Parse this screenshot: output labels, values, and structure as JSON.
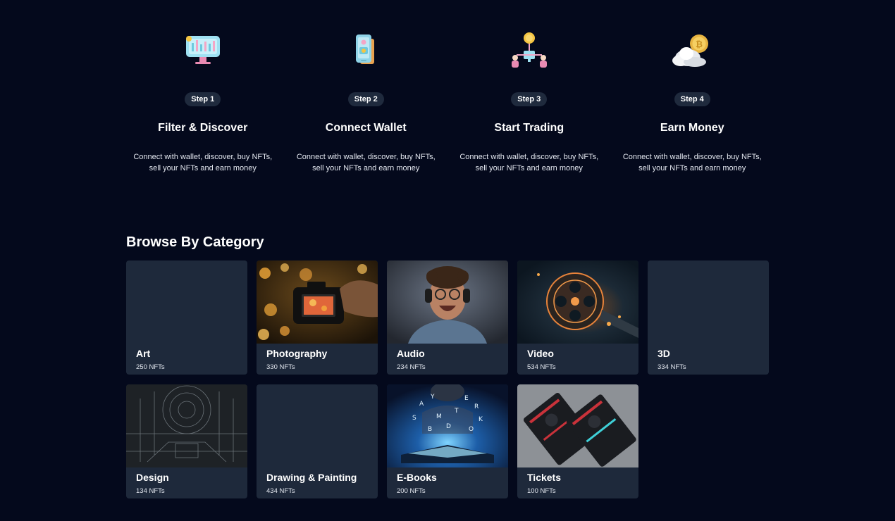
{
  "steps": [
    {
      "pill": "Step 1",
      "title": "Filter & Discover",
      "desc": "Connect with wallet, discover, buy NFTs, sell your NFTs and earn money",
      "icon": "monitor-chart-icon"
    },
    {
      "pill": "Step 2",
      "title": "Connect Wallet",
      "desc": "Connect with wallet, discover, buy NFTs, sell your NFTs and earn money",
      "icon": "phone-wallet-icon"
    },
    {
      "pill": "Step 3",
      "title": "Start Trading",
      "desc": "Connect with wallet, discover, buy NFTs, sell your NFTs and earn money",
      "icon": "trading-people-icon"
    },
    {
      "pill": "Step 4",
      "title": "Earn Money",
      "desc": "Connect with wallet, discover, buy NFTs, sell your NFTs and earn money",
      "icon": "coin-cloud-icon"
    }
  ],
  "category": {
    "heading": "Browse By Category",
    "cards": [
      {
        "name": "Art",
        "count": "250 NFTs",
        "image": "none"
      },
      {
        "name": "Photography",
        "count": "330 NFTs",
        "image": "camera-photo"
      },
      {
        "name": "Audio",
        "count": "234 NFTs",
        "image": "headphones-person-photo"
      },
      {
        "name": "Video",
        "count": "534 NFTs",
        "image": "film-reel-photo"
      },
      {
        "name": "3D",
        "count": "334 NFTs",
        "image": "none"
      },
      {
        "name": "Design",
        "count": "134 NFTs",
        "image": "blueprint-photo"
      },
      {
        "name": "Drawing & Painting",
        "count": "434 NFTs",
        "image": "none"
      },
      {
        "name": "E-Books",
        "count": "200 NFTs",
        "image": "glowing-book-photo"
      },
      {
        "name": "Tickets",
        "count": "100 NFTs",
        "image": "tickets-photo"
      }
    ]
  },
  "colors": {
    "background": "#04091c",
    "card": "#1e293b",
    "pill": "#1f2a3d"
  }
}
